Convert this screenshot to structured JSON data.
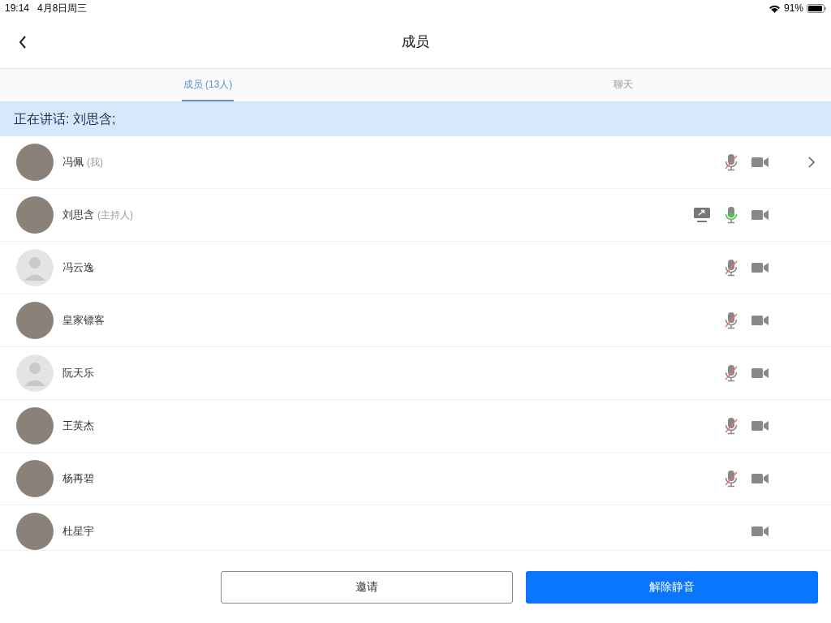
{
  "status_bar": {
    "time": "19:14",
    "date": "4月8日周三",
    "battery": "91%"
  },
  "header": {
    "title": "成员"
  },
  "tabs": [
    {
      "label": "成员 (13人)",
      "selected": true
    },
    {
      "label": "聊天",
      "selected": false
    }
  ],
  "speaking_banner": "正在讲话: 刘思含;",
  "members": [
    {
      "name": "冯佩",
      "role": "(我)",
      "has_photo": true,
      "sharing": false,
      "mic_shown": true,
      "muted": true,
      "chevron": true
    },
    {
      "name": "刘思含",
      "role": "(主持人)",
      "has_photo": true,
      "sharing": true,
      "mic_shown": true,
      "muted": false,
      "chevron": false
    },
    {
      "name": "冯云逸",
      "has_photo": false,
      "sharing": false,
      "mic_shown": true,
      "muted": true,
      "chevron": false
    },
    {
      "name": "皇家镖客",
      "has_photo": true,
      "sharing": false,
      "mic_shown": true,
      "muted": true,
      "chevron": false
    },
    {
      "name": "阮天乐",
      "has_photo": false,
      "sharing": false,
      "mic_shown": true,
      "muted": true,
      "chevron": false
    },
    {
      "name": "王英杰",
      "has_photo": true,
      "sharing": false,
      "mic_shown": true,
      "muted": true,
      "chevron": false
    },
    {
      "name": "杨再碧",
      "has_photo": true,
      "sharing": false,
      "mic_shown": true,
      "muted": true,
      "chevron": false
    },
    {
      "name": "杜星宇",
      "has_photo": true,
      "sharing": false,
      "mic_shown": false,
      "chevron": false
    }
  ],
  "buttons": [
    {
      "label": "邀请",
      "kind": "outline"
    },
    {
      "label": "解除静音",
      "kind": "primary"
    }
  ]
}
